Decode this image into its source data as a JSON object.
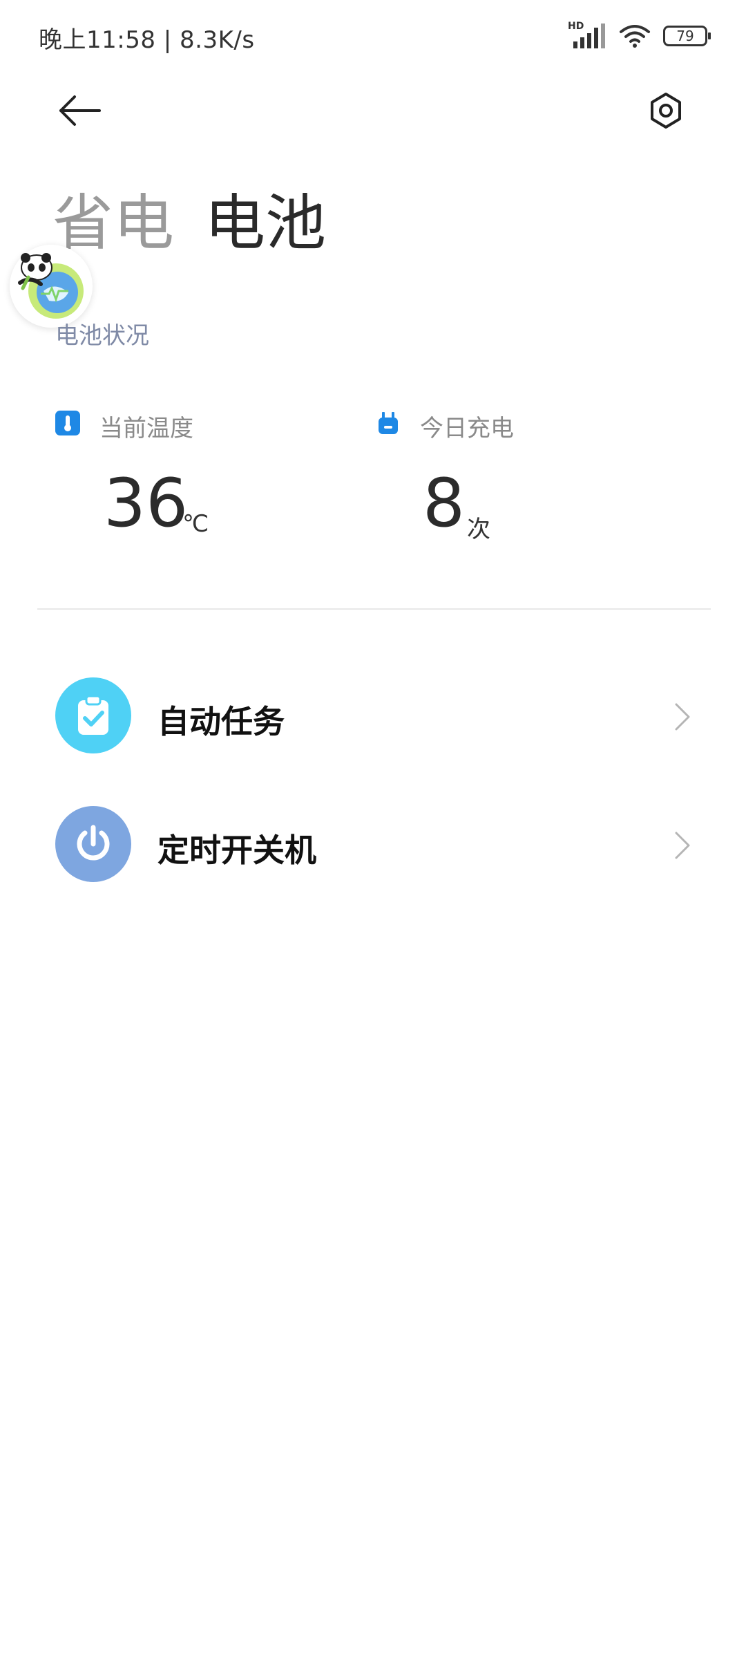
{
  "status_bar": {
    "time_speed": "晚上11:58 | 8.3K/s",
    "network_badge": "HD",
    "battery_level": "79",
    "icons": [
      "signal-icon",
      "wifi-icon",
      "battery-icon"
    ]
  },
  "header": {
    "icons": [
      "back-arrow-icon",
      "settings-gear-icon"
    ],
    "tabs": [
      {
        "label": "省电"
      },
      {
        "label": "电池"
      }
    ]
  },
  "section": {
    "title": "电池状况"
  },
  "stats": [
    {
      "label": "当前温度",
      "value": "36",
      "unit": "℃",
      "icon": "thermometer-icon",
      "color": "#1e88e5"
    },
    {
      "label": "今日充电",
      "value": "8",
      "unit": "次",
      "icon": "plug-icon",
      "color": "#1e88e5"
    }
  ],
  "menu": [
    {
      "label": "自动任务",
      "icon": "clipboard-check-icon",
      "color": "#4fd1f5"
    },
    {
      "label": "定时开关机",
      "icon": "power-icon",
      "color": "#7ea6e0"
    }
  ],
  "colors": {
    "accent": "#1e88e5",
    "section_title": "#7f8aa6",
    "tab_inactive": "#9a9a9a",
    "tab_active": "#2a2a2a"
  }
}
